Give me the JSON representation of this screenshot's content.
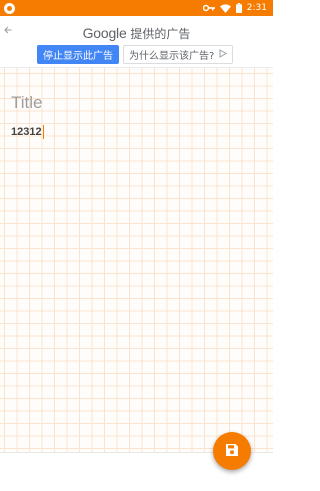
{
  "status_bar": {
    "time": "2:31",
    "icons": [
      "app-notification-icon",
      "key-icon",
      "wifi-icon",
      "battery-icon"
    ],
    "background_color": "#f57c00"
  },
  "ad": {
    "back_icon": "arrow-left-icon",
    "brand": "Google",
    "provided_text": "提供的广告",
    "stop_button_label": "停止显示此广告",
    "why_button_label": "为什么显示该广告?",
    "why_icon": "adchoices-icon"
  },
  "note": {
    "title_placeholder": "Title",
    "body_text": "12312"
  },
  "fab": {
    "icon": "save-icon",
    "color": "#f57c00"
  }
}
